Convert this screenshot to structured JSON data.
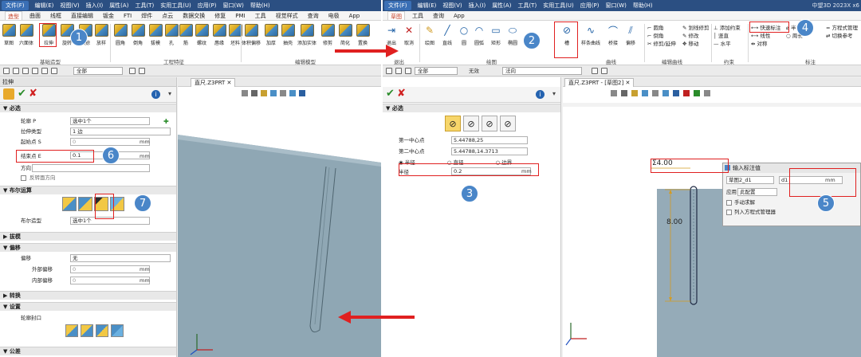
{
  "left": {
    "menubar": {
      "file": "文件(F)",
      "items": [
        "编辑(E)",
        "视图(V)",
        "插入(I)",
        "属性(A)",
        "工具(T)",
        "实用工具(U)",
        "应用(P)",
        "窗口(W)",
        "帮助(H)"
      ]
    },
    "tabs": [
      "造型",
      "曲面",
      "线框",
      "直接编辑",
      "钣金",
      "FTI",
      "焊件",
      "点云",
      "数据交换",
      "修复",
      "PMI",
      "工具",
      "视觉样式",
      "查询",
      "电极",
      "App"
    ],
    "ribbon": {
      "tools": [
        "草图",
        "六面体",
        "拉伸",
        "旋转",
        "扫掠",
        "放样",
        "圆角",
        "倒角",
        "拔模",
        "孔",
        "筋",
        "螺纹",
        "唇缘",
        "坯料",
        "体积偏移",
        "加厚",
        "抽壳",
        "添加实体",
        "修剪",
        "简化",
        "置换"
      ],
      "groups": [
        "基础造型",
        "工程特征",
        "编辑模型"
      ]
    },
    "toolbar": {
      "filter": "全部"
    },
    "panel": {
      "title": "拉伸",
      "required": "必选",
      "rows": [
        {
          "label": "轮廓 P",
          "value": "选中1个",
          "unit": ""
        },
        {
          "label": "拉伸类型",
          "value": "1 边",
          "unit": ""
        },
        {
          "label": "起始点 S",
          "value": "0",
          "unit": "mm"
        },
        {
          "label": "结束点 E",
          "value": "0.1",
          "unit": "mm"
        },
        {
          "label": "方向",
          "value": "",
          "unit": ""
        }
      ],
      "reverse": "反转面方向",
      "bool_section": "布尔运算",
      "bool_label": "布尔造型",
      "bool_value": "选中1个",
      "draft": "拔模",
      "offset_section": "偏移",
      "offset_rows": [
        {
          "label": "偏移",
          "value": "无",
          "unit": ""
        },
        {
          "label": "外部偏移",
          "value": "0",
          "unit": "mm"
        },
        {
          "label": "内部偏移",
          "value": "0",
          "unit": "mm"
        }
      ],
      "convert": "转换",
      "settings": "设置",
      "contour_close": "轮廓封口",
      "tolerance": "公差"
    },
    "viewport": {
      "tab": "直尺.Z3PRT"
    }
  },
  "right": {
    "menubar": {
      "file": "文件(F)",
      "items": [
        "编辑(E)",
        "视图(V)",
        "插入(I)",
        "属性(A)",
        "工具(T)",
        "实用工具(U)",
        "应用(P)",
        "窗口(W)",
        "帮助(H)"
      ],
      "app_title": "中望3D 2023X x6"
    },
    "tabs": [
      "草图",
      "工具",
      "查询",
      "App"
    ],
    "ribbon": {
      "tools": [
        "退出",
        "取消",
        "绘图",
        "直线",
        "圆",
        "圆弧",
        "矩形",
        "椭圆",
        "槽",
        "样条曲线",
        "桥接",
        "偏移"
      ],
      "edit_items": [
        "圆角",
        "倒角",
        "修剪/延伸"
      ],
      "edit_items2": [
        "划线修剪",
        "修改",
        "移动"
      ],
      "constraint_items": [
        "添加约束",
        "竖直",
        "水平"
      ],
      "dimension_items": [
        "快速标注",
        "线性",
        "对称",
        "半径/直径",
        "周长",
        "角度"
      ],
      "extra_items": [
        "方程式管理",
        "切换参考"
      ],
      "groups": [
        "退出",
        "绘图",
        "曲线",
        "编辑曲线",
        "约束",
        "标注"
      ]
    },
    "toolbar": {
      "filter": "全部",
      "mode": "无效",
      "dir": "法向"
    },
    "panel": {
      "required": "必选",
      "rows": [
        {
          "label": "第一中心点",
          "value": "5.44788,25",
          "unit": ""
        },
        {
          "label": "第二中心点",
          "value": "5.44788,14.3713",
          "unit": ""
        }
      ],
      "radio": [
        "半径",
        "直径",
        "边界"
      ],
      "radius_label": "半径",
      "radius_value": "0.2",
      "radius_unit": "mm"
    },
    "viewport": {
      "tab": "直尺.Z3PRT - [草图2]"
    },
    "dimension_label": "Σ4.00",
    "dimension_vertical": "8.00",
    "dialog": {
      "title": "输入标注值",
      "name": "草图2_d1",
      "value": "d1",
      "unit": "mm",
      "apply_label": "应用",
      "apply_value": "此配置",
      "opt1": "手动求解",
      "opt2": "列入方程式管理器"
    }
  },
  "badges": [
    "1",
    "2",
    "3",
    "4",
    "5",
    "6",
    "7"
  ]
}
